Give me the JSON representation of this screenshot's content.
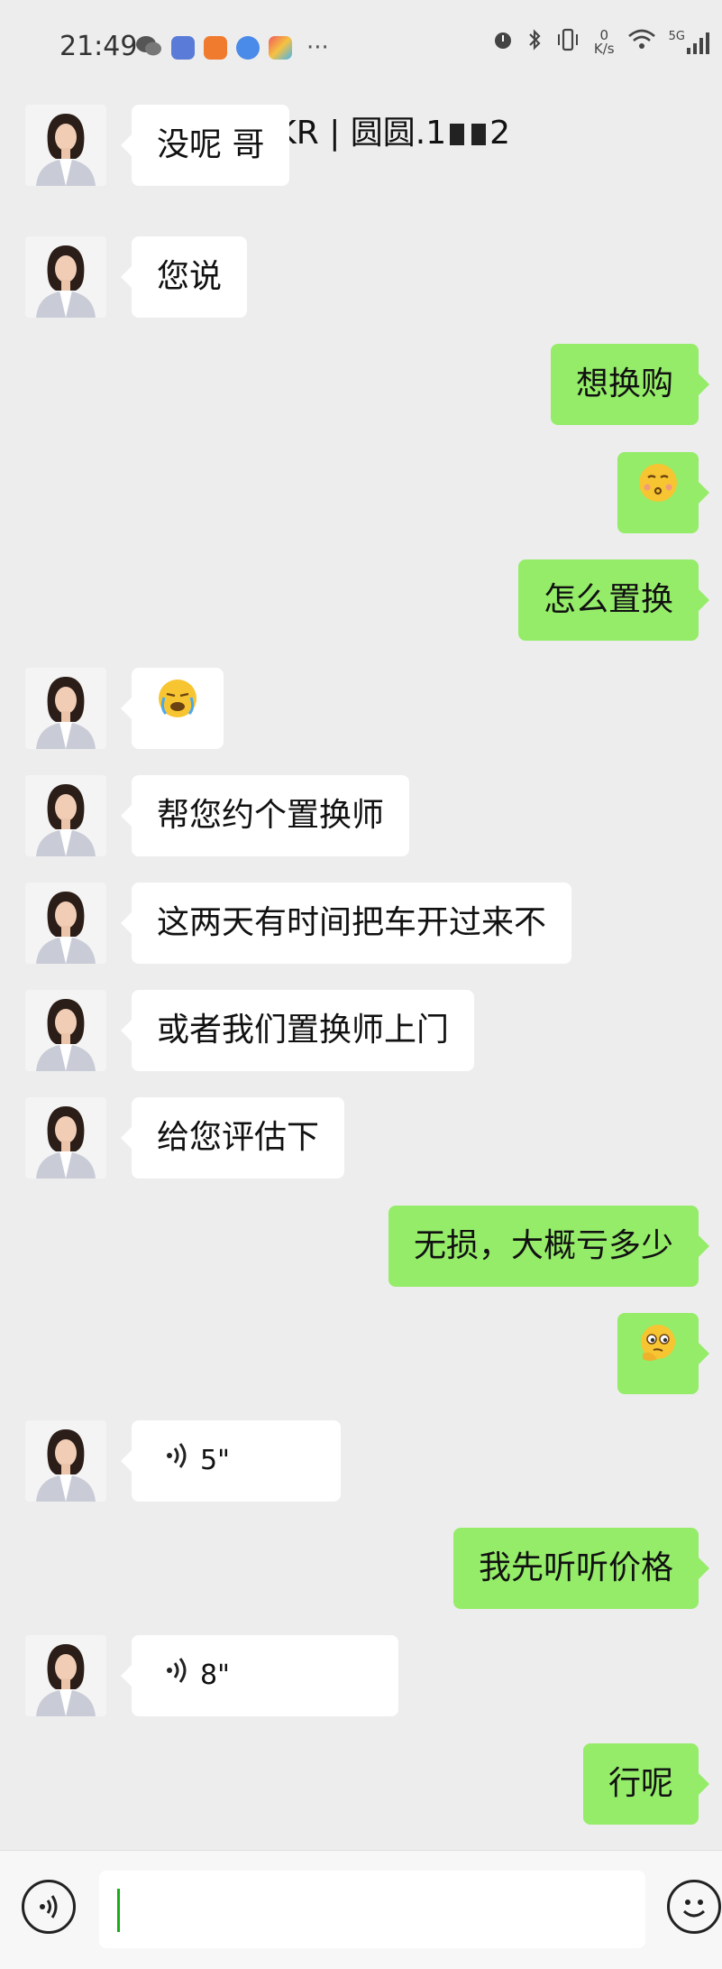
{
  "status_bar": {
    "time": "21:49",
    "net_speed_value": "0",
    "net_speed_unit": "K/s",
    "network": "5G"
  },
  "chat": {
    "title_prefix": "ZEEKR | 圆圆.1",
    "title_suffix": "2"
  },
  "messages": [
    {
      "side": "in",
      "type": "text",
      "text": "没呢 哥"
    },
    {
      "side": "in",
      "type": "text",
      "text": "您说"
    },
    {
      "side": "out",
      "type": "text",
      "text": "想换购"
    },
    {
      "side": "out",
      "type": "emoji",
      "emoji": "😚"
    },
    {
      "side": "out",
      "type": "text",
      "text": "怎么置换"
    },
    {
      "side": "in",
      "type": "emoji",
      "emoji": "😭"
    },
    {
      "side": "in",
      "type": "text",
      "text": "帮您约个置换师"
    },
    {
      "side": "in",
      "type": "text",
      "text": "这两天有时间把车开过来不"
    },
    {
      "side": "in",
      "type": "text",
      "text": "或者我们置换师上门"
    },
    {
      "side": "in",
      "type": "text",
      "text": "给您评估下"
    },
    {
      "side": "out",
      "type": "text",
      "text": "无损，大概亏多少"
    },
    {
      "side": "out",
      "type": "emoji",
      "emoji": "🤔"
    },
    {
      "side": "in",
      "type": "voice",
      "duration": "5\""
    },
    {
      "side": "out",
      "type": "text",
      "text": "我先听听价格"
    },
    {
      "side": "in",
      "type": "voice",
      "duration": "8\""
    },
    {
      "side": "out",
      "type": "text",
      "text": "行呢"
    }
  ],
  "colors": {
    "background": "#ededed",
    "outgoing_bubble": "#95ec69",
    "incoming_bubble": "#ffffff",
    "cursor": "#1aad19"
  }
}
